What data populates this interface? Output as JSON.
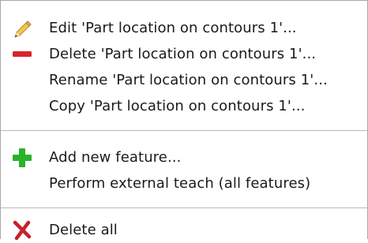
{
  "menu": {
    "items": [
      {
        "label": "Edit 'Part location on contours 1'...",
        "icon": "pencil-icon"
      },
      {
        "label": "Delete 'Part location on contours 1'...",
        "icon": "minus-icon"
      },
      {
        "label": "Rename 'Part location on contours 1'...",
        "icon": ""
      },
      {
        "label": "Copy 'Part location on contours 1'...",
        "icon": ""
      },
      {
        "label": "Add new feature...",
        "icon": "plus-icon"
      },
      {
        "label": "Perform external teach (all features)",
        "icon": ""
      },
      {
        "label": "Delete all",
        "icon": "red-x-icon"
      }
    ]
  },
  "colors": {
    "delete_red": "#d9252b",
    "add_green": "#2bb22b",
    "separator": "#b9b9b9"
  }
}
